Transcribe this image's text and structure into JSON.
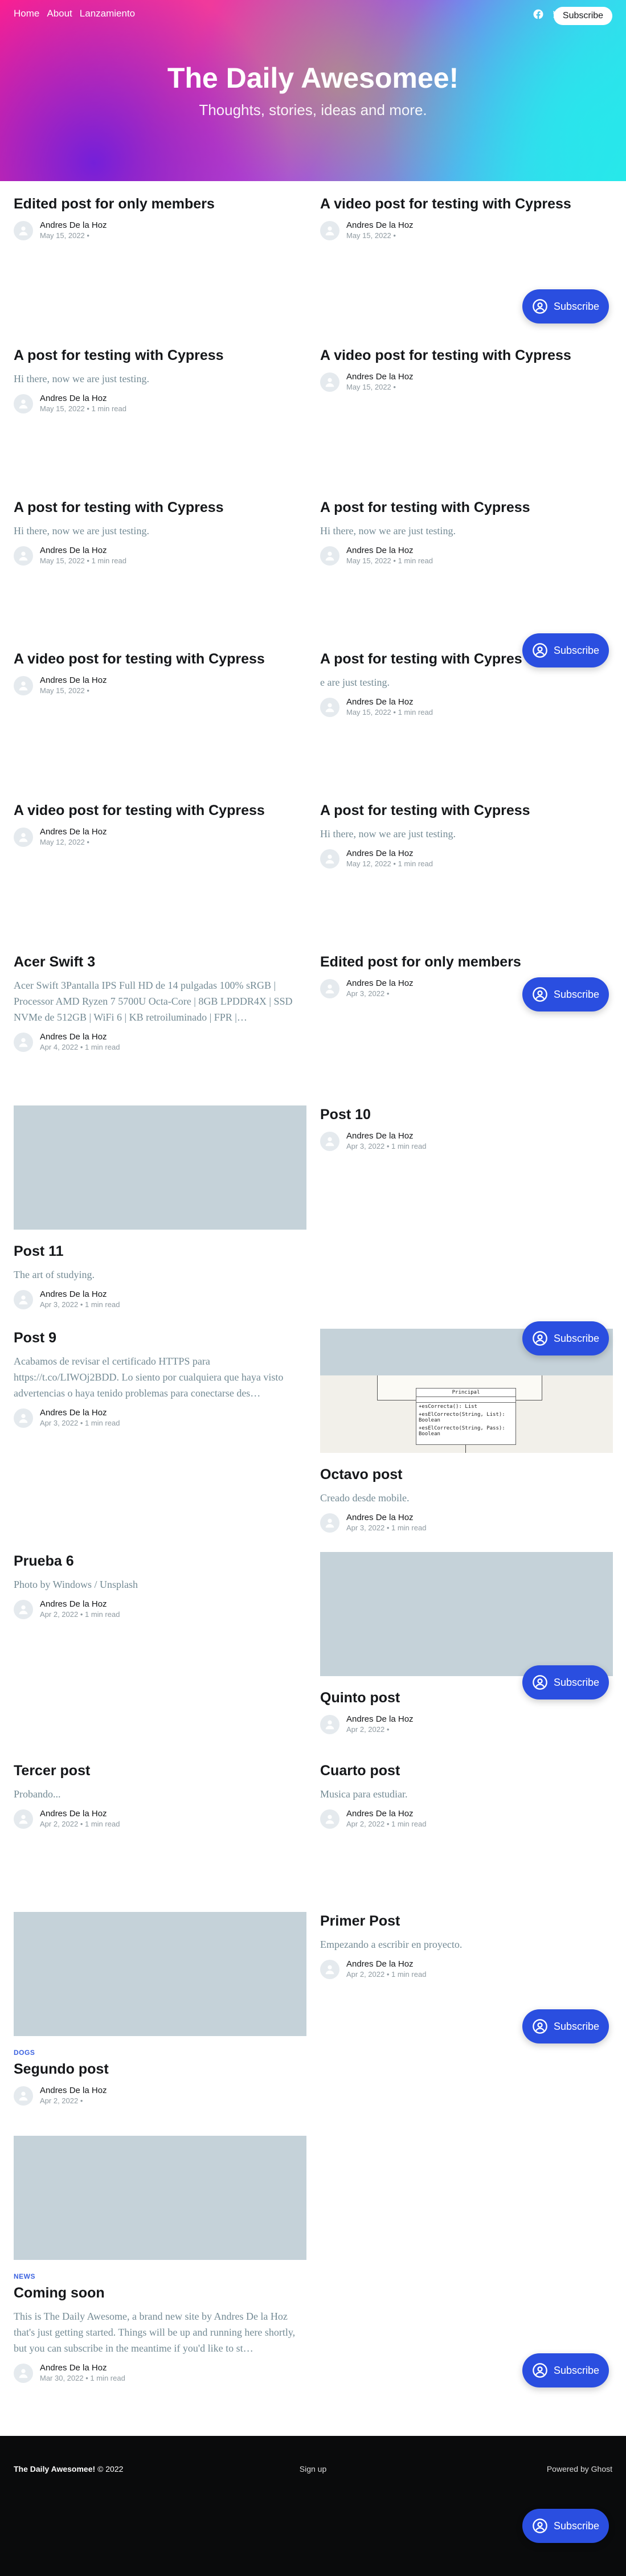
{
  "nav": {
    "items": [
      "Home",
      "About",
      "Lanzamiento"
    ]
  },
  "header_actions": {
    "subscribe_label": "Subscribe",
    "social": [
      "facebook-icon",
      "twitter-icon"
    ]
  },
  "site": {
    "title": "The Daily Awesomee!",
    "description": "Thoughts, stories, ideas and more."
  },
  "posts": [
    {
      "title": "Edited post for only members",
      "excerpt": "",
      "author": "Andres De la Hoz",
      "date": "May 15, 2022",
      "read": ""
    },
    {
      "title": "A video post for testing with Cypress",
      "excerpt": "",
      "author": "Andres De la Hoz",
      "date": "May 15, 2022",
      "read": ""
    },
    {
      "title": "A post for testing with Cypress",
      "excerpt": "Hi there, now we are just testing.",
      "author": "Andres De la Hoz",
      "date": "May 15, 2022",
      "read": "1 min read"
    },
    {
      "title": "A video post for testing with Cypress",
      "excerpt": "",
      "author": "Andres De la Hoz",
      "date": "May 15, 2022",
      "read": ""
    },
    {
      "title": "A post for testing with Cypress",
      "excerpt": "Hi there, now we are just testing.",
      "author": "Andres De la Hoz",
      "date": "May 15, 2022",
      "read": "1 min read"
    },
    {
      "title": "A post for testing with Cypress",
      "excerpt": "Hi there, now we are just testing.",
      "author": "Andres De la Hoz",
      "date": "May 15, 2022",
      "read": "1 min read"
    },
    {
      "title": "A video post for testing with Cypress",
      "excerpt": "",
      "author": "Andres De la Hoz",
      "date": "May 15, 2022",
      "read": ""
    },
    {
      "title": "A post for testing with Cypres",
      "excerpt": "e are just testing.",
      "author": "Andres De la Hoz",
      "date": "May 15, 2022",
      "read": "1 min read"
    },
    {
      "title": "A video post for testing with Cypress",
      "excerpt": "",
      "author": "Andres De la Hoz",
      "date": "May 12, 2022",
      "read": ""
    },
    {
      "title": "A post for testing with Cypress",
      "excerpt": "Hi there, now we are just testing.",
      "author": "Andres De la Hoz",
      "date": "May 12, 2022",
      "read": "1 min read"
    },
    {
      "title": "Acer Swift 3",
      "excerpt": "Acer Swift 3Pantalla IPS Full HD de 14 pulgadas 100% sRGB | Processor AMD Ryzen 7 5700U Octa-Core | 8GB LPDDR4X | SSD NVMe de 512GB | WiFi 6 | KB retroiluminado | FPR |…",
      "author": "Andres De la Hoz",
      "date": "Apr 4, 2022",
      "read": "1 min read"
    },
    {
      "title": "Edited post for only members",
      "excerpt": "",
      "author": "Andres De la Hoz",
      "date": "Apr 3, 2022",
      "read": ""
    },
    {
      "title": "Post 10",
      "excerpt": "",
      "author": "Andres De la Hoz",
      "date": "Apr 3, 2022",
      "read": "1 min read"
    },
    {
      "title": "Post 11",
      "excerpt": "The art of studying.",
      "author": "Andres De la Hoz",
      "date": "Apr 3, 2022",
      "read": "1 min read"
    },
    {
      "title": "Post 9",
      "excerpt": "Acabamos de revisar el certificado HTTPS para https://t.co/LIWOj2BDD. Lo siento por cualquiera que haya visto advertencias o haya tenido problemas para conectarse des…",
      "author": "Andres De la Hoz",
      "date": "Apr 3, 2022",
      "read": "1 min read"
    },
    {
      "title": "Octavo post",
      "excerpt": "Creado desde mobile.",
      "author": "Andres De la Hoz",
      "date": "Apr 3, 2022",
      "read": "1 min read"
    },
    {
      "title": "Prueba 6",
      "excerpt": "Photo by Windows / Unsplash",
      "author": "Andres De la Hoz",
      "date": "Apr 2, 2022",
      "read": "1 min read"
    },
    {
      "title": "Quinto post",
      "excerpt": "",
      "author": "Andres De la Hoz",
      "date": "Apr 2, 2022",
      "read": ""
    },
    {
      "title": "Tercer post",
      "excerpt": "Probando...",
      "author": "Andres De la Hoz",
      "date": "Apr 2, 2022",
      "read": "1 min read"
    },
    {
      "title": "Cuarto post",
      "excerpt": "Musica para estudiar.",
      "author": "Andres De la Hoz",
      "date": "Apr 2, 2022",
      "read": "1 min read"
    },
    {
      "title": "Primer Post",
      "excerpt": "Empezando a escribir en proyecto.",
      "author": "Andres De la Hoz",
      "date": "Apr 2, 2022",
      "read": "1 min read"
    },
    {
      "title": "Segundo post",
      "tag": "DOGS",
      "excerpt": "",
      "author": "Andres De la Hoz",
      "date": "Apr 2, 2022",
      "read": ""
    },
    {
      "title": "Coming soon",
      "tag": "NEWS",
      "excerpt": "This is The Daily Awesome, a brand new site by Andres De la Hoz that's just getting started. Things will be up and running here shortly, but you can subscribe in the meantime if you'd like to st…",
      "author": "Andres De la Hoz",
      "date": "Mar 30, 2022",
      "read": "1 min read"
    }
  ],
  "uml": {
    "title": "Principal",
    "rows": [
      "+esCorrecta(): List",
      "+esElCorrecto(String, List): Boolean",
      "+esElCorrecto(String, Pass): Boolean"
    ]
  },
  "fab": {
    "label": "Subscribe"
  },
  "footer": {
    "site": "The Daily Awesomee!",
    "copyright": "© 2022",
    "signup": "Sign up",
    "powered": "Powered by Ghost"
  }
}
